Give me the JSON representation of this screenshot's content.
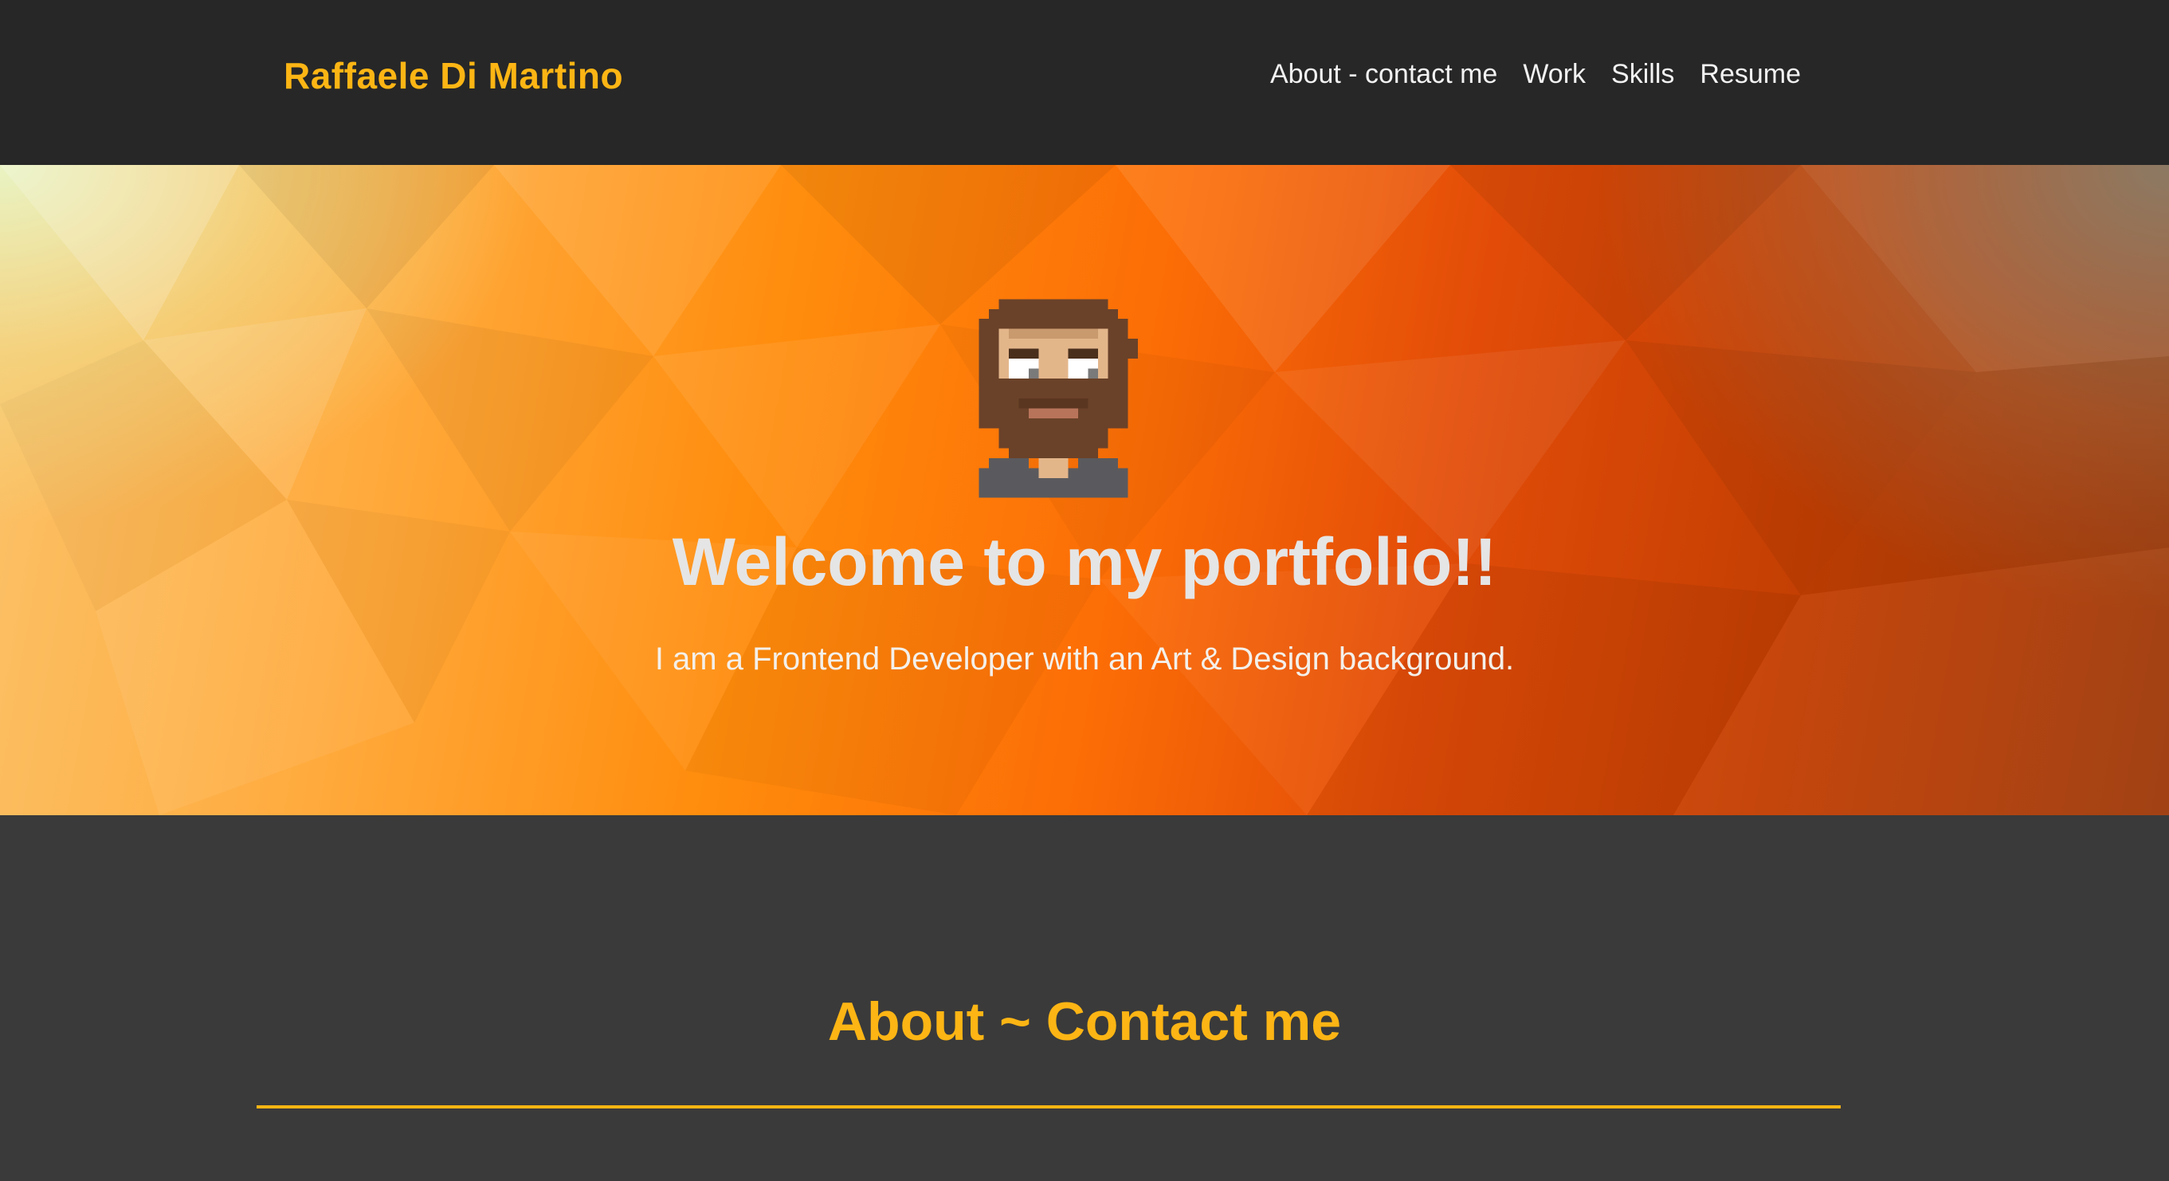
{
  "navbar": {
    "brand": "Raffaele Di Martino",
    "links": [
      "About - contact me",
      "Work",
      "Skills",
      "Resume"
    ]
  },
  "hero": {
    "avatar_icon": "pixel-art-bearded-man-icon",
    "title": "Welcome to my portfolio!!",
    "subtitle": "I am a Frontend Developer with an Art & Design background."
  },
  "about": {
    "heading": "About ~ Contact me"
  },
  "colors": {
    "accent": "#fcb514",
    "navbar_bg": "#272727",
    "section_bg": "#3a3a3a"
  }
}
